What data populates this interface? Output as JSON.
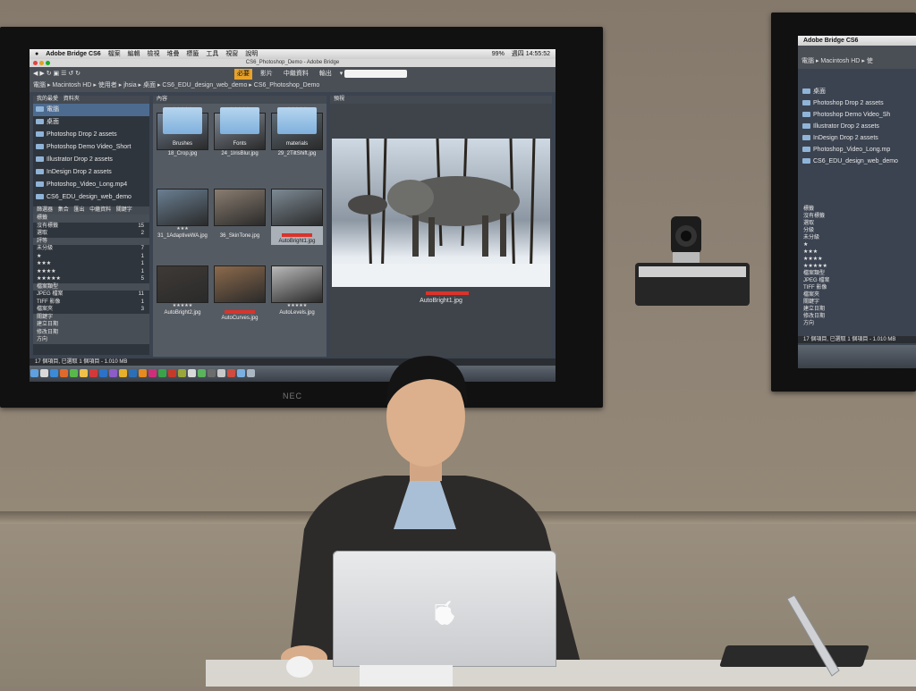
{
  "scene": {
    "tv_brand": "NEC"
  },
  "bridge_window": {
    "menubar_app": "Adobe Bridge CS6",
    "menubar_items": [
      "檔案",
      "編輯",
      "檢視",
      "堆疊",
      "標籤",
      "工具",
      "視窗",
      "說明"
    ],
    "clock": "週四 14:55:52",
    "battery": "99%",
    "window_title": "CS6_Photoshop_Demo - Adobe Bridge",
    "workspace_tabs": [
      {
        "label": "必要",
        "active": true
      },
      {
        "label": "影片",
        "active": false
      },
      {
        "label": "中繼資料",
        "active": false
      },
      {
        "label": "輸出",
        "active": false
      }
    ],
    "search_placeholder": "",
    "breadcrumb": [
      "電腦",
      "Macintosh HD",
      "使用者",
      "jhsia",
      "桌面",
      "CS6_EDU_design_web_demo",
      "CS6_Photoshop_Demo"
    ],
    "left_panel_tabs": [
      "我的最愛",
      "資料夾"
    ],
    "folders": [
      {
        "label": "電腦",
        "selected": true
      },
      {
        "label": "桌面",
        "selected": false
      },
      {
        "label": "Photoshop Drop 2 assets",
        "selected": false
      },
      {
        "label": "Photoshop Demo Video_Short",
        "selected": false
      },
      {
        "label": "Illustrator Drop 2 assets",
        "selected": false
      },
      {
        "label": "InDesign Drop 2 assets",
        "selected": false
      },
      {
        "label": "Photoshop_Video_Long.mp4",
        "selected": false
      },
      {
        "label": "CS6_EDU_design_web_demo",
        "selected": false
      }
    ],
    "filter_tabs": [
      "篩選器",
      "集合",
      "匯出",
      "中繼資料",
      "關鍵字"
    ],
    "filter_rows": [
      {
        "label": "標籤",
        "count": "",
        "head": true
      },
      {
        "label": "沒有標籤",
        "count": "15",
        "head": false
      },
      {
        "label": "選取",
        "count": "2",
        "head": false
      },
      {
        "label": "評等",
        "count": "",
        "head": true
      },
      {
        "label": "未分級",
        "count": "7",
        "head": false
      },
      {
        "label": "★",
        "count": "1",
        "head": false
      },
      {
        "label": "★★★",
        "count": "1",
        "head": false
      },
      {
        "label": "★★★★",
        "count": "1",
        "head": false
      },
      {
        "label": "★★★★★",
        "count": "5",
        "head": false
      },
      {
        "label": "檔案類型",
        "count": "",
        "head": true
      },
      {
        "label": "JPEG 檔案",
        "count": "11",
        "head": false
      },
      {
        "label": "TIFF 影像",
        "count": "1",
        "head": false
      },
      {
        "label": "檔案夾",
        "count": "3",
        "head": false
      },
      {
        "label": "關鍵字",
        "count": "",
        "head": true
      },
      {
        "label": "建立日期",
        "count": "",
        "head": true
      },
      {
        "label": "修改日期",
        "count": "",
        "head": true
      },
      {
        "label": "方向",
        "count": "",
        "head": true
      }
    ],
    "content_tab": "內容",
    "thumbnails": [
      {
        "label": "18_Crop.jpg",
        "stars": "★★★★★",
        "selected": false,
        "red_label": false,
        "kind": "image"
      },
      {
        "label": "24_1IrisBlur.jpg",
        "stars": "★★★★★",
        "selected": false,
        "red_label": false,
        "kind": "image"
      },
      {
        "label": "29_2TiltShift.jpg",
        "stars": "★★★★★",
        "selected": false,
        "red_label": false,
        "kind": "image"
      },
      {
        "label": "31_1AdaptiveWA.jpg",
        "stars": "★★★",
        "selected": false,
        "red_label": false,
        "kind": "image"
      },
      {
        "label": "36_SkinTone.jpg",
        "stars": "",
        "selected": false,
        "red_label": false,
        "kind": "image"
      },
      {
        "label": "AutoBright1.jpg",
        "stars": "",
        "selected": true,
        "red_label": true,
        "kind": "image"
      },
      {
        "label": "AutoBright2.jpg",
        "stars": "★★★★★",
        "selected": false,
        "red_label": false,
        "kind": "image"
      },
      {
        "label": "AutoCurves.jpg",
        "stars": "",
        "selected": false,
        "red_label": true,
        "kind": "image"
      },
      {
        "label": "AutoLevels.jpg",
        "stars": "★★★★★",
        "selected": false,
        "red_label": false,
        "kind": "image"
      },
      {
        "label": "Brushes",
        "stars": "",
        "selected": false,
        "red_label": false,
        "kind": "folder"
      },
      {
        "label": "Fonts",
        "stars": "",
        "selected": false,
        "red_label": false,
        "kind": "folder"
      },
      {
        "label": "materials",
        "stars": "",
        "selected": false,
        "red_label": false,
        "kind": "folder"
      }
    ],
    "preview_tab": "預視",
    "preview_caption": "AutoBright1.jpg",
    "status_text": "17 個項目, 已選取 1 個項目 - 1.010 MB"
  },
  "right_window": {
    "menubar_app": "Adobe Bridge CS6",
    "breadcrumb": [
      "電腦",
      "Macintosh HD",
      "使"
    ],
    "folders": [
      "桌面",
      "Photoshop Drop 2 assets",
      "Photoshop Demo Video_Sh",
      "Illustrator Drop 2 assets",
      "InDesign Drop 2 assets",
      "Photoshop_Video_Long.mp",
      "CS6_EDU_design_web_demo"
    ],
    "filter_rows": [
      "標籤",
      "沒有標籤",
      "選取",
      "分級",
      "未分級",
      "★",
      "★★★",
      "★★★★",
      "★★★★★",
      "檔案類型",
      "JPEG 檔案",
      "TIFF 影像",
      "檔案夾",
      "關鍵字",
      "建立日期",
      "修改日期",
      "方向"
    ],
    "status_text": "17 個項目, 已選取 1 個項目 - 1.010 MB"
  },
  "colors": {
    "wall": "#8e8275",
    "bridge_panel": "#2f353d",
    "selection_blue": "#4d6b8f",
    "label_red": "#d9342b",
    "workspace_active": "#e8a22a"
  }
}
